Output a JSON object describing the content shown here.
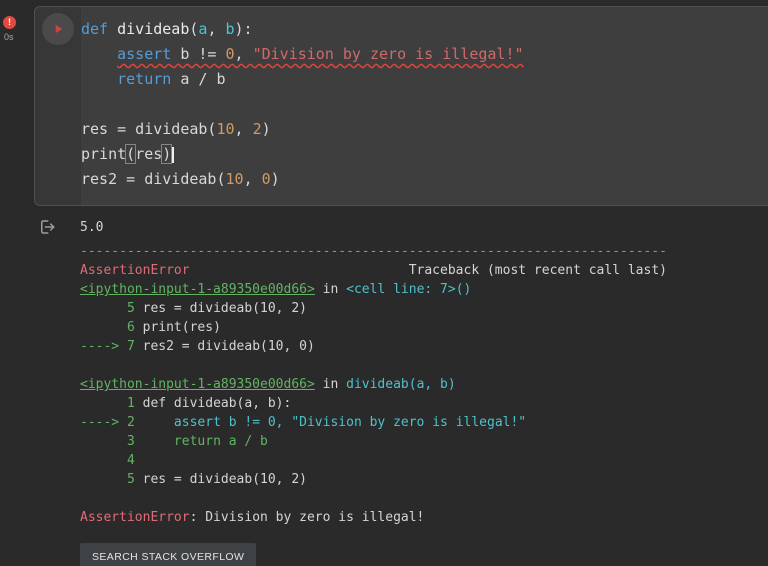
{
  "colors": {
    "kw": "#569cd6",
    "pl": "#d8d8d8",
    "fn": "#eaeaea",
    "pm": "#4dc4cf",
    "num": "#d19a66",
    "str": "#d16969",
    "tbred": "#e06c75",
    "tbgreen": "#62b462",
    "tbcyan": "#4fc1cb",
    "tbplain": "#d4d4d4",
    "pagebg": "#2a2a2a",
    "cellbg": "#3c3c3c",
    "editorbg": "#3e3e3e",
    "badge": "#e04a3f",
    "play": "#d0453a",
    "btnbg": "#3f4245",
    "squiggle": "#e0443a"
  },
  "gutter": {
    "error_badge": "!",
    "exec_time": "0s"
  },
  "editor": {
    "lines": [
      {
        "tokens": [
          {
            "t": "def",
            "c": "kw"
          },
          {
            "t": " ",
            "c": "pl"
          },
          {
            "t": "divideab",
            "c": "fn"
          },
          {
            "t": "(",
            "c": "pl"
          },
          {
            "t": "a",
            "c": "pm"
          },
          {
            "t": ", ",
            "c": "pl"
          },
          {
            "t": "b",
            "c": "pm"
          },
          {
            "t": "):",
            "c": "pl"
          }
        ]
      },
      {
        "squiggle_from": 1,
        "tokens": [
          {
            "t": "    ",
            "c": "pl"
          },
          {
            "t": "assert",
            "c": "kw"
          },
          {
            "t": " b != ",
            "c": "pl"
          },
          {
            "t": "0",
            "c": "num"
          },
          {
            "t": ", ",
            "c": "pl"
          },
          {
            "t": "\"Division by zero is illegal!\"",
            "c": "str"
          }
        ]
      },
      {
        "tokens": [
          {
            "t": "    ",
            "c": "pl"
          },
          {
            "t": "return",
            "c": "kw"
          },
          {
            "t": " a / b",
            "c": "pl"
          }
        ]
      },
      {
        "tokens": []
      },
      {
        "tokens": [
          {
            "t": "res = divideab(",
            "c": "pl"
          },
          {
            "t": "10",
            "c": "num"
          },
          {
            "t": ", ",
            "c": "pl"
          },
          {
            "t": "2",
            "c": "num"
          },
          {
            "t": ")",
            "c": "pl"
          }
        ]
      },
      {
        "cursor": true,
        "tokens": [
          {
            "t": "print",
            "c": "pl"
          },
          {
            "t": "(",
            "c": "bm"
          },
          {
            "t": "res",
            "c": "pl"
          },
          {
            "t": ")",
            "c": "bm"
          }
        ]
      },
      {
        "tokens": [
          {
            "t": "res2 = divideab(",
            "c": "pl"
          },
          {
            "t": "10",
            "c": "num"
          },
          {
            "t": ", ",
            "c": "pl"
          },
          {
            "t": "0",
            "c": "num"
          },
          {
            "t": ")",
            "c": "pl"
          }
        ]
      }
    ]
  },
  "output": {
    "button_label": "SEARCH STACK OVERFLOW",
    "lines": [
      {
        "name": "stream-output",
        "tokens": [
          {
            "t": "5.0",
            "c": "w"
          }
        ]
      },
      {
        "name": "traceback-separator",
        "gap": true,
        "tokens": [
          {
            "t": "---------------------------------------------------------------------------",
            "c": "r"
          }
        ]
      },
      {
        "name": "traceback-header",
        "left": [
          {
            "t": "AssertionError",
            "c": "r"
          }
        ],
        "right": [
          {
            "t": "Traceback (most recent call last)",
            "c": "w"
          }
        ]
      },
      {
        "name": "traceback-frame-link",
        "interactable": true,
        "tokens": [
          {
            "t": "<ipython-input-1-a89350e00d66>",
            "c": "lk"
          },
          {
            "t": " in ",
            "c": "w"
          },
          {
            "t": "<cell line: 7>()",
            "c": "c"
          }
        ]
      },
      {
        "tokens": [
          {
            "t": "      5 ",
            "c": "g"
          },
          {
            "t": "res = divideab(10, 2)",
            "c": "w"
          }
        ]
      },
      {
        "tokens": [
          {
            "t": "      6 ",
            "c": "g"
          },
          {
            "t": "print(res)",
            "c": "w"
          }
        ]
      },
      {
        "tokens": [
          {
            "t": "----> 7 ",
            "c": "g"
          },
          {
            "t": "res2 = divideab(10, 0)",
            "c": "w"
          }
        ]
      },
      {
        "tokens": []
      },
      {
        "name": "traceback-frame-link",
        "interactable": true,
        "tokens": [
          {
            "t": "<ipython-input-1-a89350e00d66>",
            "c": "lk"
          },
          {
            "t": " in ",
            "c": "w"
          },
          {
            "t": "divideab(a, b)",
            "c": "c"
          }
        ]
      },
      {
        "tokens": [
          {
            "t": "      1 ",
            "c": "g"
          },
          {
            "t": "def divideab(a, b):",
            "c": "w"
          }
        ]
      },
      {
        "tokens": [
          {
            "t": "----> 2 ",
            "c": "g"
          },
          {
            "t": "    assert b != 0, \"Division by zero is illegal!\"",
            "c": "c"
          }
        ]
      },
      {
        "tokens": [
          {
            "t": "      3 ",
            "c": "g"
          },
          {
            "t": "    return a / b",
            "c": "g"
          }
        ]
      },
      {
        "tokens": [
          {
            "t": "      4",
            "c": "g"
          }
        ]
      },
      {
        "tokens": [
          {
            "t": "      5 ",
            "c": "g"
          },
          {
            "t": "res = divideab(10, 2)",
            "c": "w"
          }
        ]
      },
      {
        "tokens": []
      },
      {
        "name": "exception-message",
        "tokens": [
          {
            "t": "AssertionError",
            "c": "r"
          },
          {
            "t": ": Division by zero is illegal!",
            "c": "w"
          }
        ]
      }
    ]
  }
}
